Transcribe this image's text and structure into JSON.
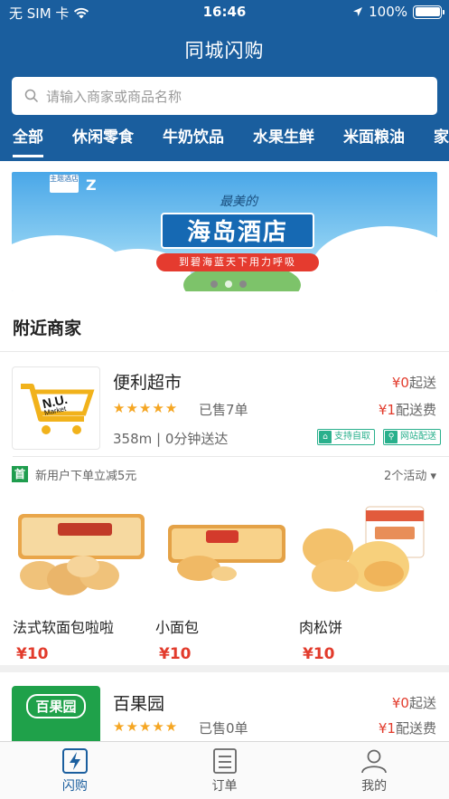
{
  "status_bar": {
    "carrier": "无 SIM 卡",
    "time": "16:46",
    "battery": "100%"
  },
  "header": {
    "title": "同城闪购"
  },
  "search": {
    "placeholder": "请输入商家或商品名称"
  },
  "categories": [
    "全部",
    "休闲零食",
    "牛奶饮品",
    "水果生鲜",
    "米面粮油",
    "家"
  ],
  "banner": {
    "script_text": "最美的",
    "title": "海岛酒店",
    "subtitle": "到碧海蓝天下用力呼吸",
    "logo_text": "主题酒店",
    "logo_mark": "Z"
  },
  "section_title": "附近商家",
  "stores": [
    {
      "name": "便利超市",
      "logo_text": "N.U. Market",
      "stars": "★★★★★",
      "sold": "已售7单",
      "distance": "358m | 0分钟送达",
      "min_price": "¥0",
      "min_label": "起送",
      "fee_price": "¥1",
      "fee_label": "配送费",
      "badges": [
        "支持自取",
        "网站配送"
      ],
      "promo_icon": "首",
      "promo_text": "新用户下单立减5元",
      "promo_more": "2个活动",
      "products": [
        {
          "name": "法式软面包啦啦",
          "price": "¥10"
        },
        {
          "name": "小面包",
          "price": "¥10"
        },
        {
          "name": "肉松饼",
          "price": "¥10"
        }
      ]
    },
    {
      "name": "百果园",
      "logo_text": "百果园",
      "stars": "★★★★★",
      "sold": "已售0单",
      "min_price": "¥0",
      "min_label": "起送",
      "fee_price": "¥1",
      "fee_label": "配送费"
    }
  ],
  "nav": [
    {
      "label": "闪购",
      "icon": "flash-icon"
    },
    {
      "label": "订单",
      "icon": "order-icon"
    },
    {
      "label": "我的",
      "icon": "user-icon"
    }
  ],
  "colors": {
    "primary": "#1a5e9e",
    "price_red": "#e23b2c",
    "star": "#f5a623",
    "badge_green": "#29b08c"
  }
}
